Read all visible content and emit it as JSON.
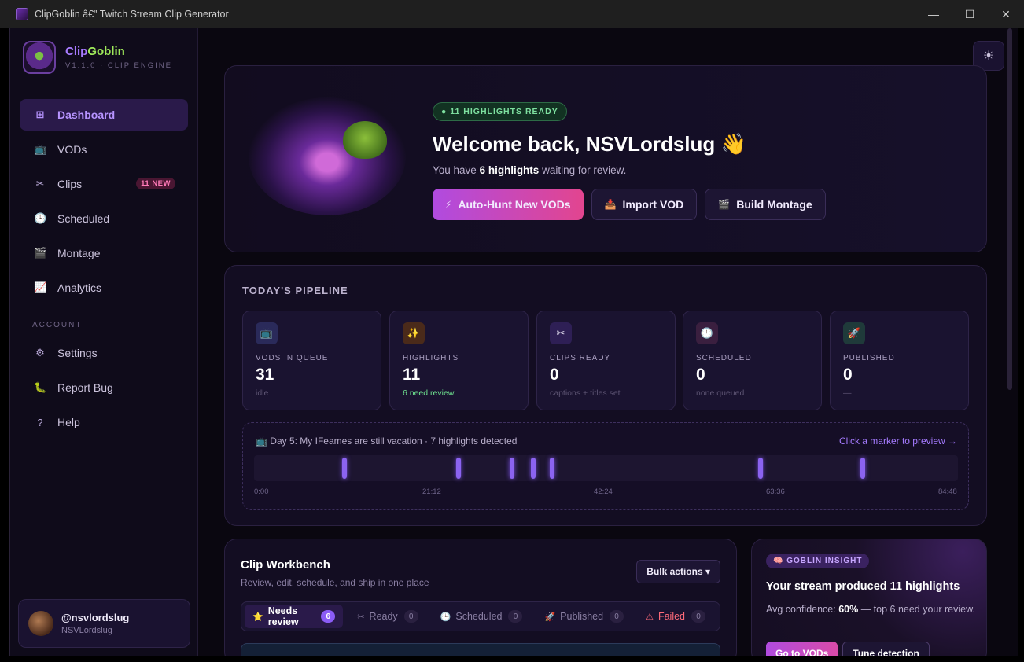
{
  "window": {
    "title": "ClipGoblin â€\" Twitch Stream Clip Generator",
    "minimize": "—",
    "maximize": "☐",
    "close": "✕"
  },
  "brand": {
    "name_a": "Clip",
    "name_b": "Goblin",
    "subtitle": "V1.1.0 · CLIP ENGINE"
  },
  "nav": {
    "items": [
      {
        "label": "Dashboard",
        "icon": "dashboard-icon",
        "glyph": "⊞"
      },
      {
        "label": "VODs",
        "icon": "tv-icon",
        "glyph": "📺"
      },
      {
        "label": "Clips",
        "icon": "scissors-icon",
        "glyph": "✂",
        "badge": "11 NEW"
      },
      {
        "label": "Scheduled",
        "icon": "clock-icon",
        "glyph": "🕒"
      },
      {
        "label": "Montage",
        "icon": "clapper-icon",
        "glyph": "🎬"
      },
      {
        "label": "Analytics",
        "icon": "chart-icon",
        "glyph": "📈"
      }
    ],
    "account_label": "ACCOUNT",
    "account_items": [
      {
        "label": "Settings",
        "icon": "gear-icon",
        "glyph": "⚙"
      },
      {
        "label": "Report Bug",
        "icon": "bug-icon",
        "glyph": "🐛"
      },
      {
        "label": "Help",
        "icon": "help-icon",
        "glyph": "?"
      }
    ]
  },
  "user": {
    "handle": "@nsvlordslug",
    "name": "NSVLordslug"
  },
  "hero": {
    "pill": "● 11 HIGHLIGHTS READY",
    "title": "Welcome back, NSVLordslug 👋",
    "sub_pre": "You have ",
    "sub_bold": "6 highlights",
    "sub_post": " waiting for review.",
    "actions": [
      {
        "label": "Auto-Hunt New VODs",
        "glyph": "⚡"
      },
      {
        "label": "Import VOD",
        "glyph": "📥"
      },
      {
        "label": "Build Montage",
        "glyph": "🎬"
      }
    ]
  },
  "pipeline": {
    "title": "TODAY'S PIPELINE",
    "stats": [
      {
        "label": "VODS IN QUEUE",
        "value": "31",
        "note": "idle",
        "glyph": "📺",
        "color": "#2a2a5a"
      },
      {
        "label": "HIGHLIGHTS",
        "value": "11",
        "note": "6 need review",
        "glyph": "✨",
        "color": "#4a2a1a"
      },
      {
        "label": "CLIPS READY",
        "value": "0",
        "note": "captions + titles set",
        "glyph": "✂",
        "color": "#2e1f55"
      },
      {
        "label": "SCHEDULED",
        "value": "0",
        "note": "none queued",
        "glyph": "🕒",
        "color": "#3a1f3f"
      },
      {
        "label": "PUBLISHED",
        "value": "0",
        "note": "—",
        "glyph": "🚀",
        "color": "#1f3a3a"
      }
    ],
    "timeline": {
      "heading": "📺 Day 5: My IFeames are still vacation · 7 highlights detected",
      "link": "Click a marker to preview →",
      "ticks": [
        "0:00",
        "21:12",
        "42:24",
        "63:36",
        "84:48"
      ],
      "markers": [
        0.128,
        0.29,
        0.366,
        0.397,
        0.423,
        0.72,
        0.865
      ]
    }
  },
  "workbench": {
    "title": "Clip Workbench",
    "subtitle": "Review, edit, schedule, and ship in one place",
    "bulk": "Bulk actions ▾",
    "tabs": [
      {
        "label": "Needs review",
        "count": "6",
        "glyph": "⭐"
      },
      {
        "label": "Ready",
        "count": "0",
        "glyph": "✂"
      },
      {
        "label": "Scheduled",
        "count": "0",
        "glyph": "🕒"
      },
      {
        "label": "Published",
        "count": "0",
        "glyph": "🚀"
      },
      {
        "label": "Failed",
        "count": "0",
        "glyph": "⚠"
      }
    ]
  },
  "insight": {
    "pill": "🧠 GOBLIN INSIGHT",
    "title": "Your stream produced 11 highlights",
    "body_pre": "Avg confidence: ",
    "body_bold": "60%",
    "body_post": " — top 6 need your review.",
    "primary": "Go to VODs",
    "secondary": "Tune detection"
  },
  "theme_toggle": "☀"
}
